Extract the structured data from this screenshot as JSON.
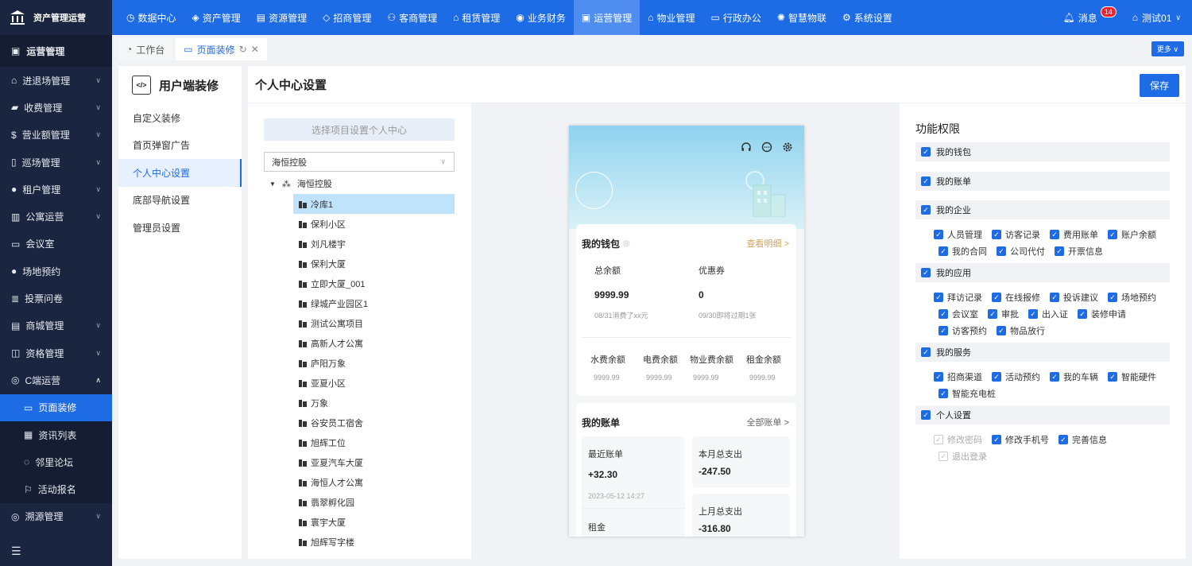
{
  "app": {
    "title": "资产管理运营"
  },
  "topnav": [
    {
      "label": "数据中心",
      "icon": "clock-icon"
    },
    {
      "label": "资产管理",
      "icon": "cube-icon"
    },
    {
      "label": "资源管理",
      "icon": "building-icon"
    },
    {
      "label": "招商管理",
      "icon": "tag-icon"
    },
    {
      "label": "客商管理",
      "icon": "users-icon"
    },
    {
      "label": "租赁管理",
      "icon": "house-icon"
    },
    {
      "label": "业务财务",
      "icon": "coin-icon"
    },
    {
      "label": "运营管理",
      "icon": "ops-icon",
      "active": true
    },
    {
      "label": "物业管理",
      "icon": "home-icon"
    },
    {
      "label": "行政办公",
      "icon": "monitor-icon"
    },
    {
      "label": "智慧物联",
      "icon": "iot-icon"
    },
    {
      "label": "系统设置",
      "icon": "gear-icon"
    }
  ],
  "topright": {
    "messages": "消息",
    "badge": "14",
    "user": "测试01"
  },
  "sidebar": {
    "header": "运营管理",
    "items": [
      {
        "label": "进退场管理",
        "icon": "gate-icon",
        "expandable": true
      },
      {
        "label": "收费管理",
        "icon": "wallet-icon",
        "expandable": true
      },
      {
        "label": "营业额管理",
        "icon": "dollar-icon",
        "expandable": true
      },
      {
        "label": "巡场管理",
        "icon": "map-icon",
        "expandable": true
      },
      {
        "label": "租户管理",
        "icon": "user-icon",
        "expandable": true
      },
      {
        "label": "公寓运营",
        "icon": "apartment-icon",
        "expandable": true
      },
      {
        "label": "会议室",
        "icon": "meeting-icon"
      },
      {
        "label": "场地预约",
        "icon": "person-icon"
      },
      {
        "label": "投票问卷",
        "icon": "vote-icon"
      },
      {
        "label": "商城管理",
        "icon": "shop-icon",
        "expandable": true
      },
      {
        "label": "资格管理",
        "icon": "qualify-icon",
        "expandable": true
      },
      {
        "label": "C端运营",
        "icon": "c-icon",
        "expanded": true
      }
    ],
    "subitems": [
      {
        "label": "页面装修",
        "icon": "page-icon",
        "active": true
      },
      {
        "label": "资讯列表",
        "icon": "news-icon"
      },
      {
        "label": "邻里论坛",
        "icon": "forum-icon"
      },
      {
        "label": "活动报名",
        "icon": "flag-icon"
      }
    ],
    "after": [
      {
        "label": "溯源管理",
        "icon": "trace-icon",
        "expandable": true
      }
    ]
  },
  "tabs": [
    {
      "label": "工作台",
      "icon": "dashboard-icon"
    },
    {
      "label": "页面装修",
      "icon": "page-icon",
      "active": true
    }
  ],
  "more": "更多",
  "leftmenu": {
    "title": "用户端装修",
    "items": [
      {
        "label": "自定义装修"
      },
      {
        "label": "首页弹窗广告"
      },
      {
        "label": "个人中心设置",
        "active": true
      },
      {
        "label": "底部导航设置"
      },
      {
        "label": "管理员设置"
      }
    ]
  },
  "main": {
    "title": "个人中心设置",
    "save": "保存"
  },
  "project": {
    "button": "选择项目设置个人中心",
    "select": "海恒控股",
    "root": "海恒控股",
    "items": [
      "冷库1",
      "保利小区",
      "刘凡楼宇",
      "保利大厦",
      "立即大厦_001",
      "绿城产业园区1",
      "测试公寓项目",
      "高新人才公寓",
      "庐阳万象",
      "亚夏小区",
      "万象",
      "谷安员工宿舍",
      "旭辉工位",
      "亚夏汽车大厦",
      "海恒人才公寓",
      "翡翠孵化园",
      "寰宇大厦",
      "旭辉写字楼"
    ]
  },
  "phone": {
    "wallet": {
      "title": "我的钱包",
      "link": "查看明细 >",
      "balance_label": "总余额",
      "balance": "9999.99",
      "balance_note": "08/31消费了xx元",
      "coupon_label": "优惠券",
      "coupon": "0",
      "coupon_note": "09/30即将过期1张",
      "sub": [
        {
          "label": "水费余额",
          "value": "9999.99"
        },
        {
          "label": "电费余额",
          "value": "9999.99"
        },
        {
          "label": "物业费余额",
          "value": "9999.99"
        },
        {
          "label": "租金余额",
          "value": "9999.99"
        }
      ]
    },
    "bills": {
      "title": "我的账单",
      "link": "全部账单 >",
      "recent_label": "最近账单",
      "recent": "+32.30",
      "recent_time": "2023-05-12 14:27",
      "month_label": "本月总支出",
      "month": "-247.50",
      "last_label": "上月总支出",
      "last": "-316.80",
      "rent_label": "租金"
    }
  },
  "funcs": {
    "title": "功能权限",
    "groups": [
      {
        "label": "我的钱包"
      },
      {
        "label": "我的账单"
      },
      {
        "label": "我的企业",
        "rows": [
          [
            "人员管理",
            "访客记录",
            "费用账单",
            "账户余额"
          ],
          [
            "我的合同",
            "公司代付",
            "开票信息"
          ]
        ]
      },
      {
        "label": "我的应用",
        "rows": [
          [
            "拜访记录",
            "在线报修",
            "投诉建议",
            "场地预约"
          ],
          [
            "会议室",
            "审批",
            "出入证",
            "装修申请"
          ],
          [
            "访客预约",
            "物品放行"
          ]
        ]
      },
      {
        "label": "我的服务",
        "rows": [
          [
            "招商渠道",
            "活动预约",
            "我的车辆",
            "智能硬件"
          ],
          [
            "智能充电桩"
          ]
        ]
      },
      {
        "label": "个人设置",
        "rows": [
          [
            "修改密码",
            "修改手机号",
            "完善信息"
          ],
          [
            "退出登录"
          ]
        ]
      }
    ]
  }
}
